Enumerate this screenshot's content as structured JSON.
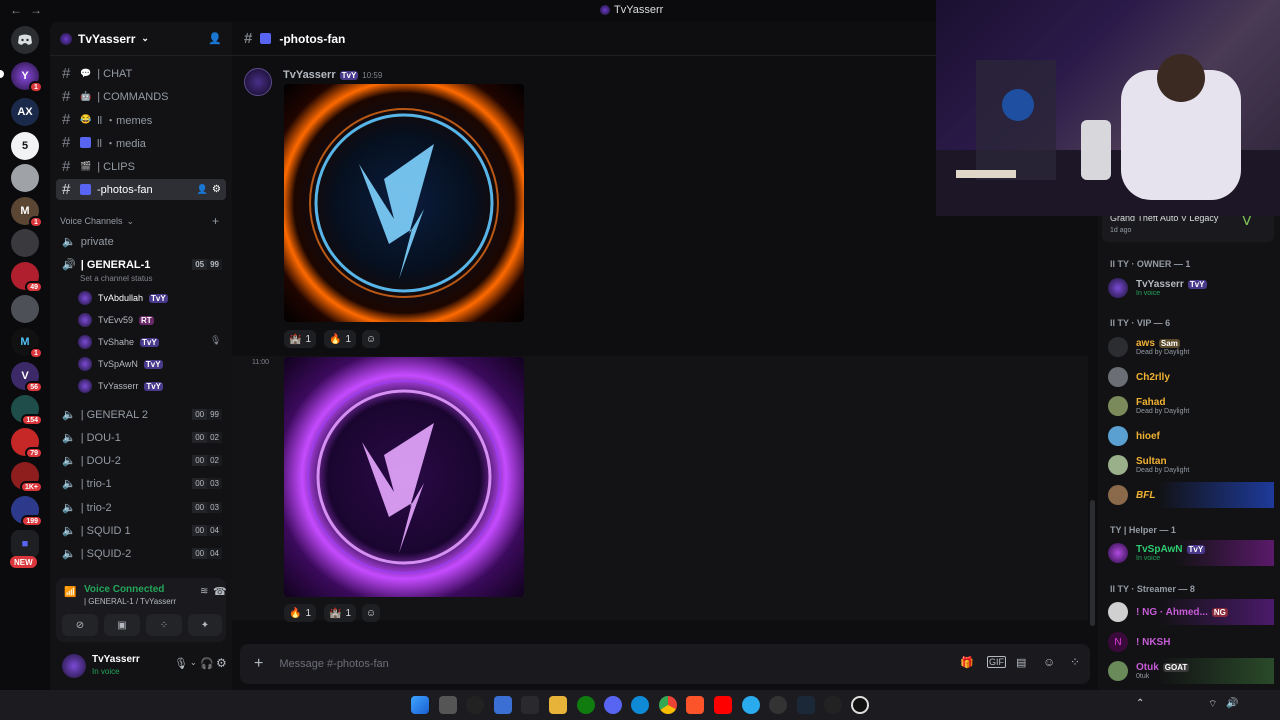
{
  "window": {
    "title": "TvYasserr"
  },
  "rail": {
    "badges": [
      "1",
      "1",
      "1",
      "49",
      "1",
      "56",
      "154",
      "79",
      "1K+",
      "199"
    ],
    "new_label": "NEW"
  },
  "server": {
    "name": "TvYasserr",
    "text_channels": [
      {
        "name": "| CHAT"
      },
      {
        "name": "| COMMANDS"
      },
      {
        "name": "ll ・memes"
      },
      {
        "name": "ll ・media"
      },
      {
        "name": "| CLIPS"
      },
      {
        "name": "-photos-fan",
        "active": true
      }
    ],
    "voice_section": "Voice Channels",
    "voice_channels": [
      {
        "name": "private"
      },
      {
        "name": "| GENERAL-1",
        "count_a": "05",
        "count_b": "99",
        "status": "Set a channel status"
      },
      {
        "name": "| GENERAL 2",
        "count_a": "00",
        "count_b": "99"
      },
      {
        "name": "| DOU-1",
        "count_a": "00",
        "count_b": "02"
      },
      {
        "name": "| DOU-2",
        "count_a": "00",
        "count_b": "02"
      },
      {
        "name": "| trio-1",
        "count_a": "00",
        "count_b": "03"
      },
      {
        "name": "| trio-2",
        "count_a": "00",
        "count_b": "03"
      },
      {
        "name": "| SQUID 1",
        "count_a": "00",
        "count_b": "04"
      },
      {
        "name": "| SQUID-2",
        "count_a": "00",
        "count_b": "04"
      }
    ],
    "voice_members": [
      {
        "name": "TvAbdullah",
        "tag": "TvY"
      },
      {
        "name": "TvEvv59",
        "tag": "RT"
      },
      {
        "name": "TvShahe",
        "tag": "TvY"
      },
      {
        "name": "TvSpAwN",
        "tag": "TvY"
      },
      {
        "name": "TvYasserr",
        "tag": "TvY"
      }
    ]
  },
  "voice_panel": {
    "status": "Voice Connected",
    "channel": "| GENERAL-1 / TvYasserr"
  },
  "user_panel": {
    "name": "TvYasserr",
    "status": "In voice"
  },
  "chat": {
    "channel": "-photos-fan",
    "author": "TvYasserr",
    "author_tag": "TvY",
    "time1": "10:59",
    "time2": "11:00",
    "reactions1": [
      {
        "count": "1"
      },
      {
        "count": "1"
      }
    ],
    "reactions2": [
      {
        "count": "1"
      },
      {
        "count": "1"
      }
    ],
    "composer_placeholder": "Message #-photos-fan"
  },
  "activity": {
    "game": "Grand Theft Auto V Legacy",
    "ago": "1d ago"
  },
  "members": {
    "owner_section": "ll TY · OWNER — 1",
    "owner": {
      "name": "TvYasserr",
      "tag": "TvY",
      "status": "In voice"
    },
    "vip_section": "ll TY · VIP — 6",
    "vip": [
      {
        "name": "aws",
        "tag": "Sam",
        "status": "Dead by Daylight"
      },
      {
        "name": "Ch2rlly",
        "status": ""
      },
      {
        "name": "Fahad",
        "status": "Dead by Daylight"
      },
      {
        "name": "hioef",
        "status": ""
      },
      {
        "name": "Sultan",
        "status": "Dead by Daylight"
      },
      {
        "name": "BFL",
        "status": ""
      }
    ],
    "helper_section": "TY | Helper — 1",
    "helper": {
      "name": "TvSpAwN",
      "tag": "TvY",
      "status": "In voice"
    },
    "streamer_section": "ll TY · Streamer — 8",
    "streamers": [
      {
        "name": "! NG · Ahmed...",
        "tag": "NG"
      },
      {
        "name": "! NKSH"
      },
      {
        "name": "Otuk",
        "tag": "GOAT",
        "status": "0tuk"
      }
    ]
  },
  "colors": {
    "accent": "#5865f2",
    "online": "#23a55a",
    "dnd": "#f23f43",
    "vip_gold": "#f0b232",
    "streamer": "#c65bd6"
  }
}
